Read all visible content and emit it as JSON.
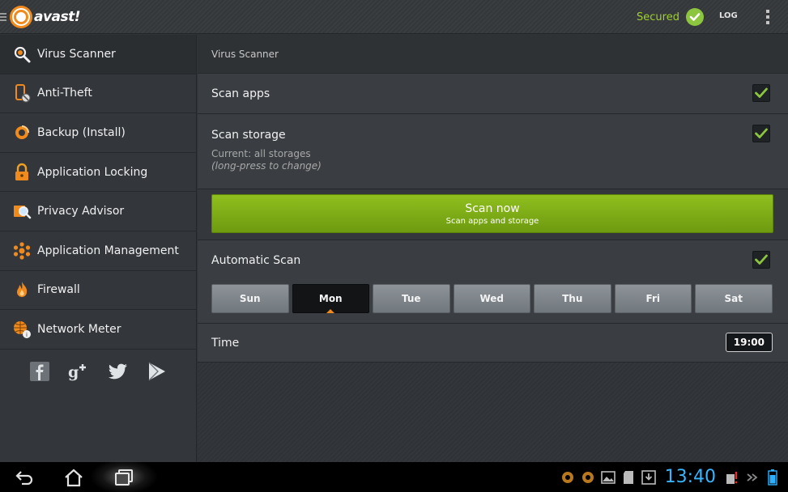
{
  "app": {
    "brand": "avast!",
    "status_text": "Secured",
    "log_label": "LOG",
    "accent_color": "#f08a1c",
    "secure_color": "#8cc63f"
  },
  "sidebar": {
    "items": [
      {
        "label": "Virus Scanner",
        "icon": "virus-scanner-icon",
        "active": true
      },
      {
        "label": "Anti-Theft",
        "icon": "anti-theft-icon"
      },
      {
        "label": "Backup (Install)",
        "icon": "backup-icon"
      },
      {
        "label": "Application Locking",
        "icon": "lock-icon"
      },
      {
        "label": "Privacy Advisor",
        "icon": "privacy-icon"
      },
      {
        "label": "Application Management",
        "icon": "app-management-icon"
      },
      {
        "label": "Firewall",
        "icon": "firewall-icon"
      },
      {
        "label": "Network Meter",
        "icon": "network-meter-icon"
      }
    ],
    "social": [
      "facebook-icon",
      "google-plus-icon",
      "twitter-icon",
      "play-store-icon"
    ]
  },
  "main": {
    "header": "Virus Scanner",
    "scan_apps": {
      "label": "Scan apps",
      "checked": true
    },
    "scan_storage": {
      "label": "Scan storage",
      "current": "Current: all storages",
      "hint": "(long-press to change)",
      "checked": true
    },
    "scan_now": {
      "label": "Scan now",
      "sub": "Scan apps and storage"
    },
    "automatic_scan": {
      "label": "Automatic Scan",
      "checked": true
    },
    "days": [
      {
        "label": "Sun",
        "selected": false
      },
      {
        "label": "Mon",
        "selected": true
      },
      {
        "label": "Tue",
        "selected": false
      },
      {
        "label": "Wed",
        "selected": false
      },
      {
        "label": "Thu",
        "selected": false
      },
      {
        "label": "Fri",
        "selected": false
      },
      {
        "label": "Sat",
        "selected": false
      }
    ],
    "time": {
      "label": "Time",
      "value": "19:00"
    }
  },
  "system_bar": {
    "clock": "13:40"
  }
}
